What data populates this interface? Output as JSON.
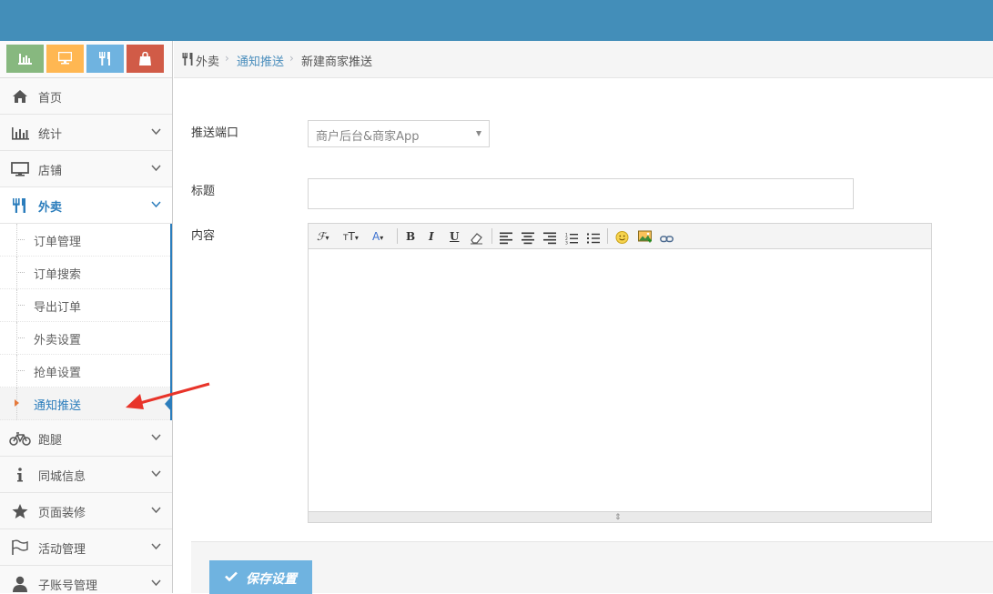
{
  "colors": {
    "topbar": "#438eb9",
    "accent": "#2b7dbc",
    "annotation_arrow": "#e8342a"
  },
  "shortcuts": [
    {
      "icon": "bar-chart-icon",
      "color": "#87b87f"
    },
    {
      "icon": "desktop-icon",
      "color": "#ffb752"
    },
    {
      "icon": "cutlery-icon",
      "color": "#6fb3e0"
    },
    {
      "icon": "shopping-bag-icon",
      "color": "#d15b47"
    }
  ],
  "sidebar": {
    "items": [
      {
        "label": "首页",
        "icon": "home-icon"
      },
      {
        "label": "统计",
        "icon": "bar-chart-icon"
      },
      {
        "label": "店铺",
        "icon": "desktop-icon"
      },
      {
        "label": "外卖",
        "icon": "cutlery-icon"
      }
    ],
    "submenu": [
      {
        "label": "订单管理"
      },
      {
        "label": "订单搜索"
      },
      {
        "label": "导出订单"
      },
      {
        "label": "外卖设置"
      },
      {
        "label": "抢单设置"
      },
      {
        "label": "通知推送"
      }
    ],
    "items_after": [
      {
        "label": "跑腿",
        "icon": "bicycle-icon"
      },
      {
        "label": "同城信息",
        "icon": "info-icon"
      },
      {
        "label": "页面装修",
        "icon": "star-icon"
      },
      {
        "label": "活动管理",
        "icon": "flag-icon"
      },
      {
        "label": "子账号管理",
        "icon": "user-icon"
      }
    ]
  },
  "breadcrumb": {
    "root": "外卖",
    "parent": "通知推送",
    "current": "新建商家推送"
  },
  "form": {
    "push_target_label": "推送端口",
    "push_target_value": "商户后台&商家App",
    "title_label": "标题",
    "title_value": "",
    "content_label": "内容",
    "save_label": "保存设置"
  },
  "editor_toolbar": [
    "font-family-tool",
    "font-size-tool",
    "font-color-tool",
    "bold-tool",
    "italic-tool",
    "underline-tool",
    "remove-format-tool",
    "align-left-tool",
    "align-center-tool",
    "align-right-tool",
    "ordered-list-tool",
    "unordered-list-tool",
    "emoticon-tool",
    "image-tool",
    "link-tool"
  ]
}
